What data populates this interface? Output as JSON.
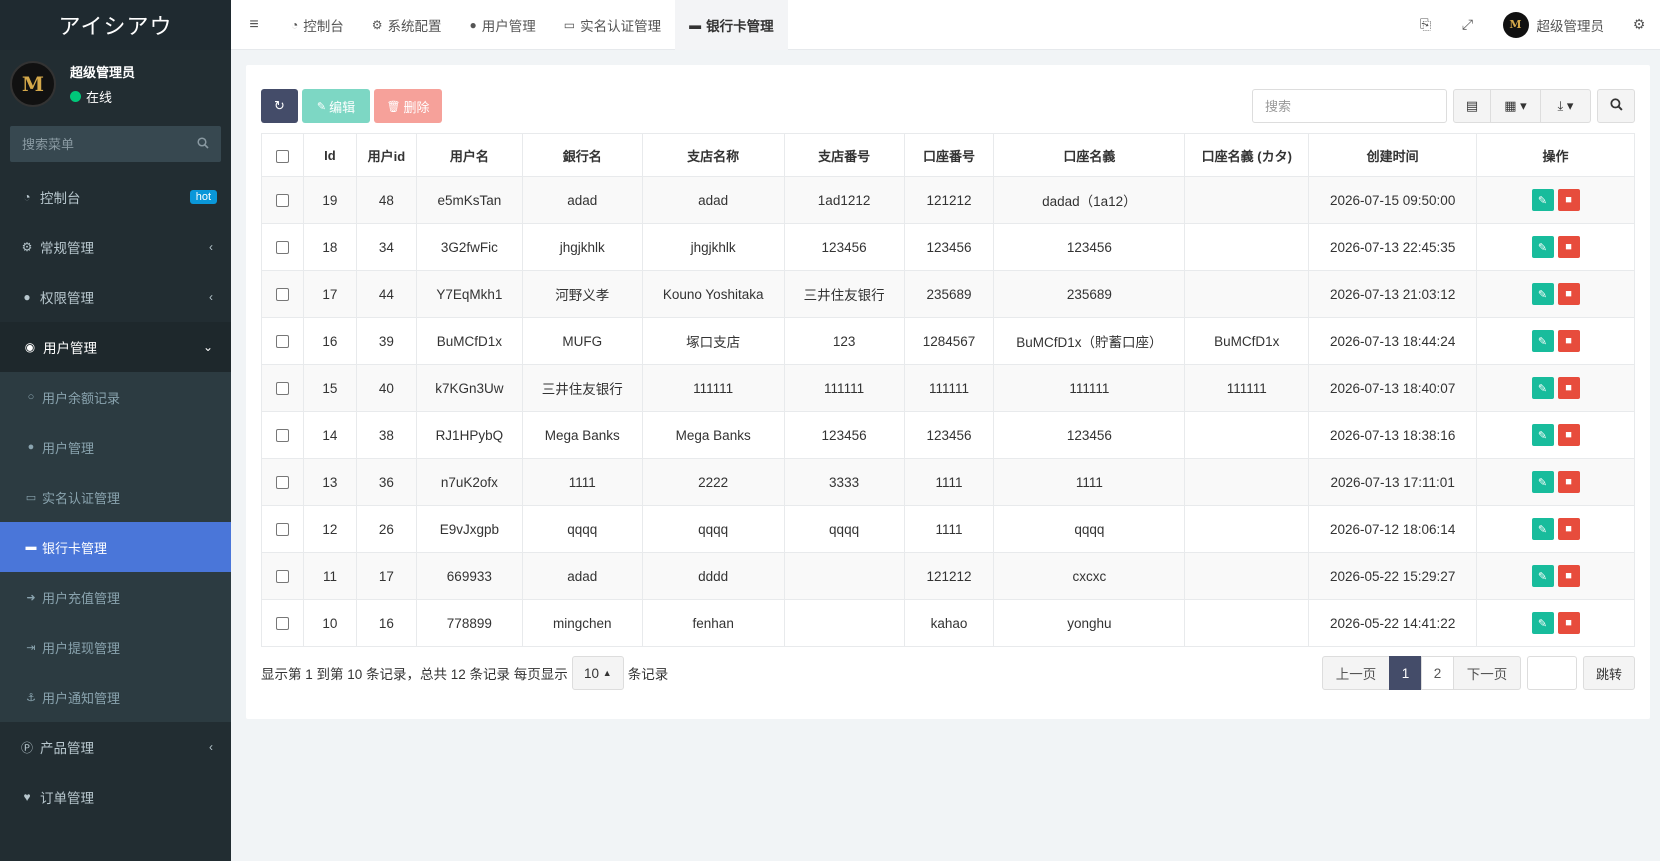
{
  "brand": "アイシアウ",
  "user": {
    "name": "超级管理员",
    "status": "在线",
    "avatar_letter": "M"
  },
  "sidebar": {
    "search_placeholder": "搜索菜单",
    "items": [
      {
        "label": "控制台",
        "icon": "dashboard-icon",
        "badge": "hot"
      },
      {
        "label": "常规管理",
        "icon": "cogs-icon"
      },
      {
        "label": "权限管理",
        "icon": "users-icon"
      },
      {
        "label": "用户管理",
        "icon": "user-circle-icon",
        "open": true
      }
    ],
    "subitems": [
      {
        "label": "用户余额记录",
        "icon": "circle-o-icon"
      },
      {
        "label": "用户管理",
        "icon": "user-icon"
      },
      {
        "label": "实名认证管理",
        "icon": "id-card-icon"
      },
      {
        "label": "银行卡管理",
        "icon": "credit-card-icon",
        "active": true
      },
      {
        "label": "用户充值管理",
        "icon": "sign-in-icon"
      },
      {
        "label": "用户提现管理",
        "icon": "sign-out-icon"
      },
      {
        "label": "用户通知管理",
        "icon": "anchor-icon"
      }
    ],
    "items_after": [
      {
        "label": "产品管理",
        "icon": "product-icon"
      },
      {
        "label": "订单管理",
        "icon": "heartbeat-icon"
      }
    ]
  },
  "topbar": {
    "tabs": [
      {
        "label": "控制台",
        "icon": "dashboard-icon"
      },
      {
        "label": "系统配置",
        "icon": "gear-icon"
      },
      {
        "label": "用户管理",
        "icon": "user-icon"
      },
      {
        "label": "实名认证管理",
        "icon": "id-card-icon"
      },
      {
        "label": "银行卡管理",
        "icon": "credit-card-icon",
        "active": true
      }
    ],
    "account_name": "超级管理员"
  },
  "toolbar": {
    "edit_label": "编辑",
    "delete_label": "删除",
    "search_placeholder": "搜索"
  },
  "table": {
    "columns": [
      "Id",
      "用户id",
      "用户名",
      "銀行名",
      "支店名称",
      "支店番号",
      "口座番号",
      "口座名義",
      "口座名義 (カタ)",
      "创建时间",
      "操作"
    ],
    "rows": [
      [
        "19",
        "48",
        "e5mKsTan",
        "adad",
        "adad",
        "1ad1212",
        "121212",
        "dadad（1a12）",
        "",
        "2026-07-15 09:50:00"
      ],
      [
        "18",
        "34",
        "3G2fwFic",
        "jhgjkhlk",
        "jhgjkhlk",
        "123456",
        "123456",
        "123456",
        "",
        "2026-07-13 22:45:35"
      ],
      [
        "17",
        "44",
        "Y7EqMkh1",
        "河野义孝",
        "Kouno Yoshitaka",
        "三井住友银行",
        "235689",
        "235689",
        "",
        "2026-07-13 21:03:12"
      ],
      [
        "16",
        "39",
        "BuMCfD1x",
        "MUFG",
        "塚口支店",
        "123",
        "1284567",
        "BuMCfD1x（貯蓄口座）",
        "BuMCfD1x",
        "2026-07-13 18:44:24"
      ],
      [
        "15",
        "40",
        "k7KGn3Uw",
        "三井住友银行",
        "111111",
        "111111",
        "111111",
        "111111",
        "111111",
        "2026-07-13 18:40:07"
      ],
      [
        "14",
        "38",
        "RJ1HPybQ",
        "Mega Banks",
        "Mega Banks",
        "123456",
        "123456",
        "123456",
        "",
        "2026-07-13 18:38:16"
      ],
      [
        "13",
        "36",
        "n7uK2ofx",
        "1111",
        "2222",
        "3333",
        "1111",
        "1111",
        "",
        "2026-07-13 17:11:01"
      ],
      [
        "12",
        "26",
        "E9vJxgpb",
        "qqqq",
        "qqqq",
        "qqqq",
        "1111",
        "qqqq",
        "",
        "2026-07-12 18:06:14"
      ],
      [
        "11",
        "17",
        "669933",
        "adad",
        "dddd",
        "",
        "121212",
        "cxcxc",
        "",
        "2026-05-22 15:29:27"
      ],
      [
        "10",
        "16",
        "778899",
        "mingchen",
        "fenhan",
        "",
        "kahao",
        "yonghu",
        "",
        "2026-05-22 14:41:22"
      ]
    ]
  },
  "footer": {
    "summary": "显示第 1 到第 10 条记录，总共 12 条记录 每页显示",
    "per_page": "10",
    "per_page_suffix": "条记录",
    "prev": "上一页",
    "pages": [
      "1",
      "2"
    ],
    "current_page": "1",
    "next": "下一页",
    "jump": "跳转"
  }
}
